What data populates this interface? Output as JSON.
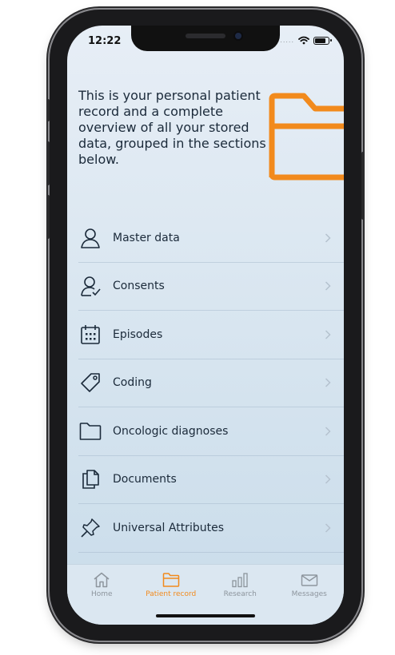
{
  "status_bar": {
    "time": "12:22",
    "signal_dots": "....."
  },
  "intro_text": "This is your personal patient record and a complete overview of all your stored data, grouped in the sections below.",
  "menu": [
    {
      "label": "Master data",
      "icon": "person-icon"
    },
    {
      "label": "Consents",
      "icon": "person-check-icon"
    },
    {
      "label": "Episodes",
      "icon": "calendar-icon"
    },
    {
      "label": "Coding",
      "icon": "tag-icon"
    },
    {
      "label": "Oncologic diagnoses",
      "icon": "folder-icon"
    },
    {
      "label": "Documents",
      "icon": "documents-icon"
    },
    {
      "label": "Universal Attributes",
      "icon": "pin-icon"
    }
  ],
  "tabs": [
    {
      "label": "Home",
      "icon": "home-icon",
      "active": false
    },
    {
      "label": "Patient record",
      "icon": "folder-icon",
      "active": true
    },
    {
      "label": "Research",
      "icon": "bar-chart-icon",
      "active": false
    },
    {
      "label": "Messages",
      "icon": "envelope-icon",
      "active": false
    }
  ],
  "colors": {
    "accent": "#f28a1c",
    "text": "#1b2a3a",
    "inactive": "#8d959d"
  }
}
